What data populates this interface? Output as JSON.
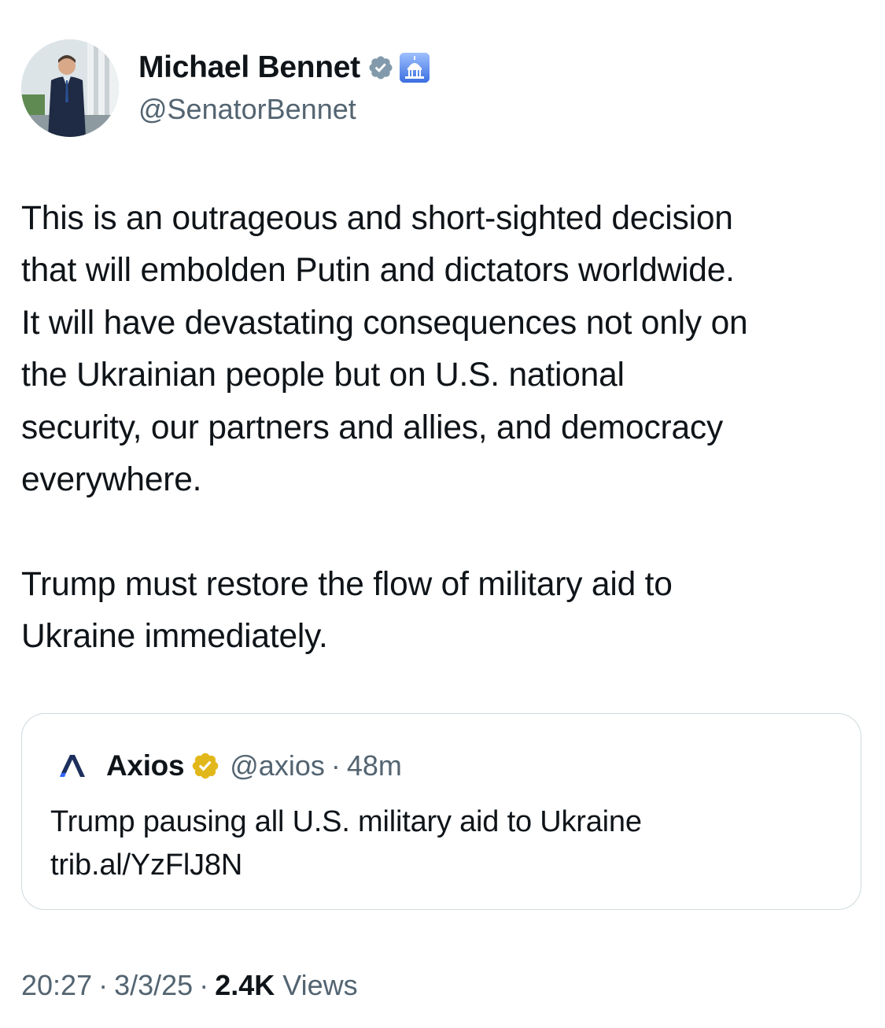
{
  "author": {
    "display_name": "Michael Bennet",
    "handle": "@SenatorBennet",
    "badges": [
      "verified-icon",
      "capitol-icon"
    ],
    "avatar": "avatar"
  },
  "tweet": {
    "paragraph_1": "This is an outrageous and short-sighted decision\nthat will embolden Putin and dictators worldwide.\nIt will have devastating consequences not only on\nthe Ukrainian people but on U.S. national\nsecurity, our partners and allies, and democracy\neverywhere.",
    "paragraph_2": "Trump must restore the flow of military aid to\nUkraine immediately."
  },
  "quote": {
    "logo": "axios-logo-icon",
    "name": "Axios",
    "badge": "gold-verified-icon",
    "handle": "@axios",
    "separator": "·",
    "time": "48m",
    "text_line_1": "Trump pausing all U.S. military aid to Ukraine",
    "text_line_2": "trib.al/YzFlJ8N"
  },
  "meta": {
    "time": "20:27",
    "separator": "·",
    "date": "3/3/25",
    "views_count": "2.4K",
    "views_label": "Views"
  },
  "colors": {
    "text_primary": "#0f1419",
    "text_secondary": "#536471",
    "border": "#cfd9de",
    "verified_grey": "#829aab",
    "verified_gold": "#e2b719",
    "capitol_blue": "#3b82f6"
  }
}
